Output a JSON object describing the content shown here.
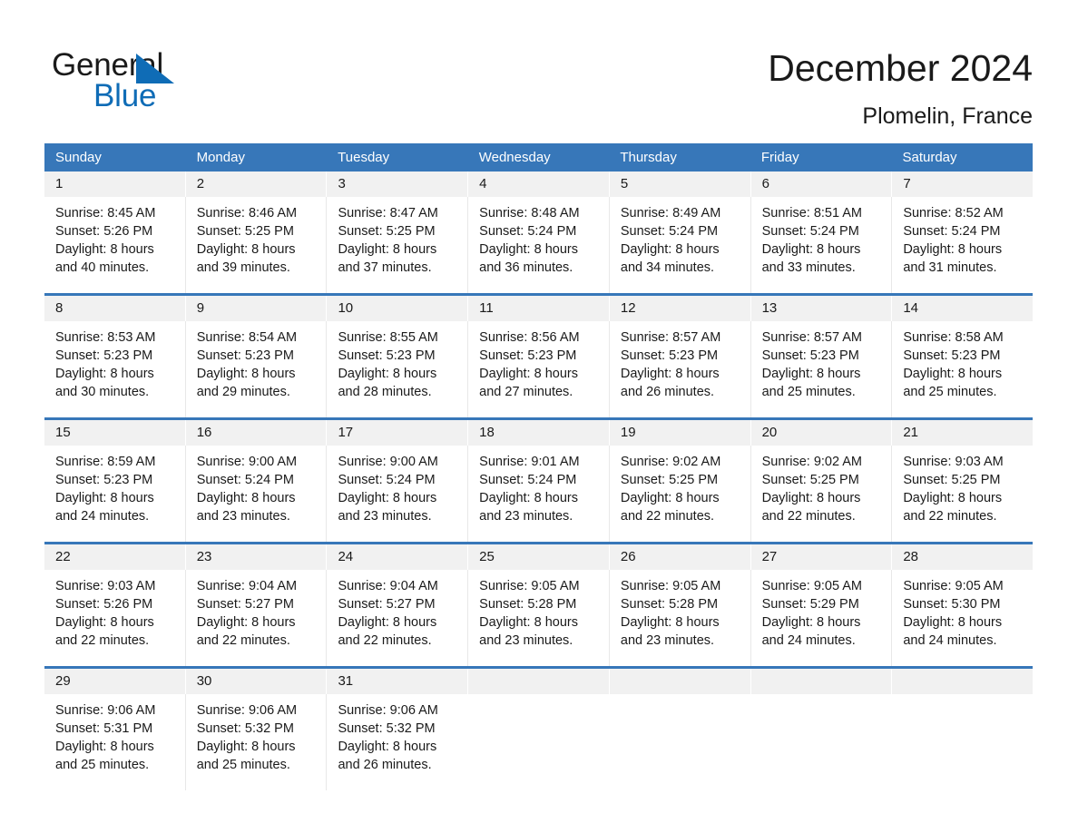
{
  "brand": {
    "name_part1": "General",
    "name_part2": "Blue",
    "triangle_color": "#0f6cb6"
  },
  "header": {
    "title": "December 2024",
    "location": "Plomelin, France"
  },
  "theme": {
    "header_blue": "#3777b9",
    "date_band_gray": "#f1f1f1",
    "text_dark": "#1a1a1a",
    "brand_blue": "#0f6cb6"
  },
  "calendar": {
    "weekdays": [
      "Sunday",
      "Monday",
      "Tuesday",
      "Wednesday",
      "Thursday",
      "Friday",
      "Saturday"
    ],
    "weeks": [
      {
        "days": [
          {
            "date": "1",
            "sunrise": "Sunrise: 8:45 AM",
            "sunset": "Sunset: 5:26 PM",
            "daylight1": "Daylight: 8 hours",
            "daylight2": "and 40 minutes."
          },
          {
            "date": "2",
            "sunrise": "Sunrise: 8:46 AM",
            "sunset": "Sunset: 5:25 PM",
            "daylight1": "Daylight: 8 hours",
            "daylight2": "and 39 minutes."
          },
          {
            "date": "3",
            "sunrise": "Sunrise: 8:47 AM",
            "sunset": "Sunset: 5:25 PM",
            "daylight1": "Daylight: 8 hours",
            "daylight2": "and 37 minutes."
          },
          {
            "date": "4",
            "sunrise": "Sunrise: 8:48 AM",
            "sunset": "Sunset: 5:24 PM",
            "daylight1": "Daylight: 8 hours",
            "daylight2": "and 36 minutes."
          },
          {
            "date": "5",
            "sunrise": "Sunrise: 8:49 AM",
            "sunset": "Sunset: 5:24 PM",
            "daylight1": "Daylight: 8 hours",
            "daylight2": "and 34 minutes."
          },
          {
            "date": "6",
            "sunrise": "Sunrise: 8:51 AM",
            "sunset": "Sunset: 5:24 PM",
            "daylight1": "Daylight: 8 hours",
            "daylight2": "and 33 minutes."
          },
          {
            "date": "7",
            "sunrise": "Sunrise: 8:52 AM",
            "sunset": "Sunset: 5:24 PM",
            "daylight1": "Daylight: 8 hours",
            "daylight2": "and 31 minutes."
          }
        ]
      },
      {
        "days": [
          {
            "date": "8",
            "sunrise": "Sunrise: 8:53 AM",
            "sunset": "Sunset: 5:23 PM",
            "daylight1": "Daylight: 8 hours",
            "daylight2": "and 30 minutes."
          },
          {
            "date": "9",
            "sunrise": "Sunrise: 8:54 AM",
            "sunset": "Sunset: 5:23 PM",
            "daylight1": "Daylight: 8 hours",
            "daylight2": "and 29 minutes."
          },
          {
            "date": "10",
            "sunrise": "Sunrise: 8:55 AM",
            "sunset": "Sunset: 5:23 PM",
            "daylight1": "Daylight: 8 hours",
            "daylight2": "and 28 minutes."
          },
          {
            "date": "11",
            "sunrise": "Sunrise: 8:56 AM",
            "sunset": "Sunset: 5:23 PM",
            "daylight1": "Daylight: 8 hours",
            "daylight2": "and 27 minutes."
          },
          {
            "date": "12",
            "sunrise": "Sunrise: 8:57 AM",
            "sunset": "Sunset: 5:23 PM",
            "daylight1": "Daylight: 8 hours",
            "daylight2": "and 26 minutes."
          },
          {
            "date": "13",
            "sunrise": "Sunrise: 8:57 AM",
            "sunset": "Sunset: 5:23 PM",
            "daylight1": "Daylight: 8 hours",
            "daylight2": "and 25 minutes."
          },
          {
            "date": "14",
            "sunrise": "Sunrise: 8:58 AM",
            "sunset": "Sunset: 5:23 PM",
            "daylight1": "Daylight: 8 hours",
            "daylight2": "and 25 minutes."
          }
        ]
      },
      {
        "days": [
          {
            "date": "15",
            "sunrise": "Sunrise: 8:59 AM",
            "sunset": "Sunset: 5:23 PM",
            "daylight1": "Daylight: 8 hours",
            "daylight2": "and 24 minutes."
          },
          {
            "date": "16",
            "sunrise": "Sunrise: 9:00 AM",
            "sunset": "Sunset: 5:24 PM",
            "daylight1": "Daylight: 8 hours",
            "daylight2": "and 23 minutes."
          },
          {
            "date": "17",
            "sunrise": "Sunrise: 9:00 AM",
            "sunset": "Sunset: 5:24 PM",
            "daylight1": "Daylight: 8 hours",
            "daylight2": "and 23 minutes."
          },
          {
            "date": "18",
            "sunrise": "Sunrise: 9:01 AM",
            "sunset": "Sunset: 5:24 PM",
            "daylight1": "Daylight: 8 hours",
            "daylight2": "and 23 minutes."
          },
          {
            "date": "19",
            "sunrise": "Sunrise: 9:02 AM",
            "sunset": "Sunset: 5:25 PM",
            "daylight1": "Daylight: 8 hours",
            "daylight2": "and 22 minutes."
          },
          {
            "date": "20",
            "sunrise": "Sunrise: 9:02 AM",
            "sunset": "Sunset: 5:25 PM",
            "daylight1": "Daylight: 8 hours",
            "daylight2": "and 22 minutes."
          },
          {
            "date": "21",
            "sunrise": "Sunrise: 9:03 AM",
            "sunset": "Sunset: 5:25 PM",
            "daylight1": "Daylight: 8 hours",
            "daylight2": "and 22 minutes."
          }
        ]
      },
      {
        "days": [
          {
            "date": "22",
            "sunrise": "Sunrise: 9:03 AM",
            "sunset": "Sunset: 5:26 PM",
            "daylight1": "Daylight: 8 hours",
            "daylight2": "and 22 minutes."
          },
          {
            "date": "23",
            "sunrise": "Sunrise: 9:04 AM",
            "sunset": "Sunset: 5:27 PM",
            "daylight1": "Daylight: 8 hours",
            "daylight2": "and 22 minutes."
          },
          {
            "date": "24",
            "sunrise": "Sunrise: 9:04 AM",
            "sunset": "Sunset: 5:27 PM",
            "daylight1": "Daylight: 8 hours",
            "daylight2": "and 22 minutes."
          },
          {
            "date": "25",
            "sunrise": "Sunrise: 9:05 AM",
            "sunset": "Sunset: 5:28 PM",
            "daylight1": "Daylight: 8 hours",
            "daylight2": "and 23 minutes."
          },
          {
            "date": "26",
            "sunrise": "Sunrise: 9:05 AM",
            "sunset": "Sunset: 5:28 PM",
            "daylight1": "Daylight: 8 hours",
            "daylight2": "and 23 minutes."
          },
          {
            "date": "27",
            "sunrise": "Sunrise: 9:05 AM",
            "sunset": "Sunset: 5:29 PM",
            "daylight1": "Daylight: 8 hours",
            "daylight2": "and 24 minutes."
          },
          {
            "date": "28",
            "sunrise": "Sunrise: 9:05 AM",
            "sunset": "Sunset: 5:30 PM",
            "daylight1": "Daylight: 8 hours",
            "daylight2": "and 24 minutes."
          }
        ]
      },
      {
        "days": [
          {
            "date": "29",
            "sunrise": "Sunrise: 9:06 AM",
            "sunset": "Sunset: 5:31 PM",
            "daylight1": "Daylight: 8 hours",
            "daylight2": "and 25 minutes."
          },
          {
            "date": "30",
            "sunrise": "Sunrise: 9:06 AM",
            "sunset": "Sunset: 5:32 PM",
            "daylight1": "Daylight: 8 hours",
            "daylight2": "and 25 minutes."
          },
          {
            "date": "31",
            "sunrise": "Sunrise: 9:06 AM",
            "sunset": "Sunset: 5:32 PM",
            "daylight1": "Daylight: 8 hours",
            "daylight2": "and 26 minutes."
          },
          {
            "date": "",
            "sunrise": "",
            "sunset": "",
            "daylight1": "",
            "daylight2": ""
          },
          {
            "date": "",
            "sunrise": "",
            "sunset": "",
            "daylight1": "",
            "daylight2": ""
          },
          {
            "date": "",
            "sunrise": "",
            "sunset": "",
            "daylight1": "",
            "daylight2": ""
          },
          {
            "date": "",
            "sunrise": "",
            "sunset": "",
            "daylight1": "",
            "daylight2": ""
          }
        ]
      }
    ]
  }
}
